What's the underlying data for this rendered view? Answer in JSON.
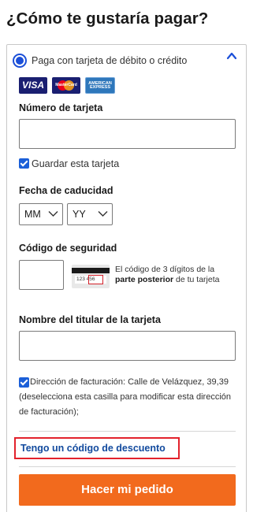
{
  "page": {
    "title": "¿Cómo te gustaría pagar?"
  },
  "payment_option": {
    "label": "Paga con tarjeta de débito o crédito",
    "selected": true
  },
  "card_logos": {
    "visa": "VISA",
    "mastercard": "MasterCard",
    "amex_line1": "AMERICAN",
    "amex_line2": "EXPRESS"
  },
  "card_number": {
    "label": "Número de tarjeta",
    "value": ""
  },
  "save_card": {
    "label": "Guardar esta tarjeta",
    "checked": true
  },
  "expiry": {
    "label": "Fecha de caducidad",
    "month_value": "MM",
    "year_value": "YY"
  },
  "security_code": {
    "label": "Código de seguridad",
    "value": "",
    "card_digits": "123 456",
    "help_prefix": "El código de 3 dígitos de la ",
    "help_bold": "parte posterior",
    "help_suffix": " de tu tarjeta"
  },
  "cardholder": {
    "label": "Nombre del titular de la tarjeta",
    "value": ""
  },
  "billing": {
    "checked": true,
    "text": "Dirección de facturación: Calle de Velázquez, 39,39 (deselecciona esta casilla para modificar esta dirección de facturación);"
  },
  "discount": {
    "label": "Tengo un código de descuento"
  },
  "submit": {
    "label": "Hacer mi pedido"
  },
  "colors": {
    "accent_blue": "#1b4fd8",
    "button_orange": "#f26a1d",
    "highlight_red": "#e3222c",
    "link_blue": "#124a9e"
  }
}
